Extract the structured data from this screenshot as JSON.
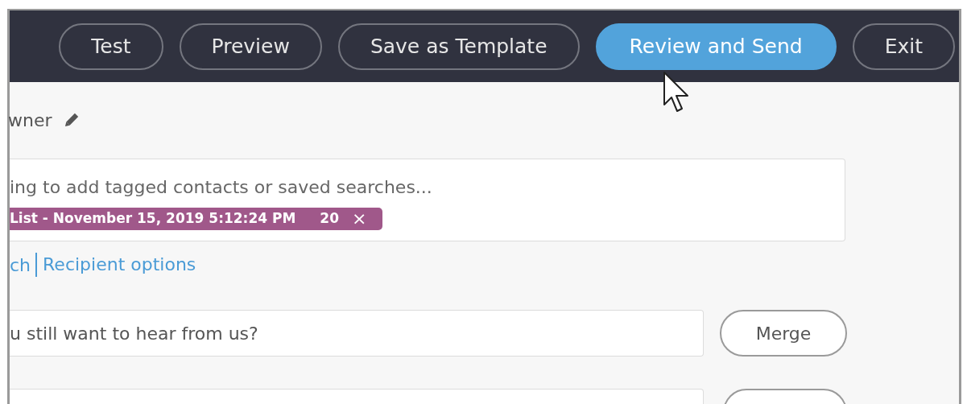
{
  "toolbar": {
    "buttons": [
      {
        "label": "Test",
        "kind": "outline"
      },
      {
        "label": "Preview",
        "kind": "outline"
      },
      {
        "label": "Save as Template",
        "kind": "outline"
      },
      {
        "label": "Review and Send",
        "kind": "primary"
      },
      {
        "label": "Exit",
        "kind": "outline"
      }
    ]
  },
  "owner": {
    "label": "wner"
  },
  "recipients": {
    "placeholder": "ing to add tagged contacts or saved searches...",
    "tags": [
      {
        "label": "List - November 15, 2019 5:12:24 PM",
        "count": "20",
        "remove": "×",
        "color": "#a0588a"
      }
    ],
    "links": [
      "ch",
      "Recipient options"
    ]
  },
  "subject": {
    "value": "u still want to hear from us?",
    "button": "Merge"
  }
}
